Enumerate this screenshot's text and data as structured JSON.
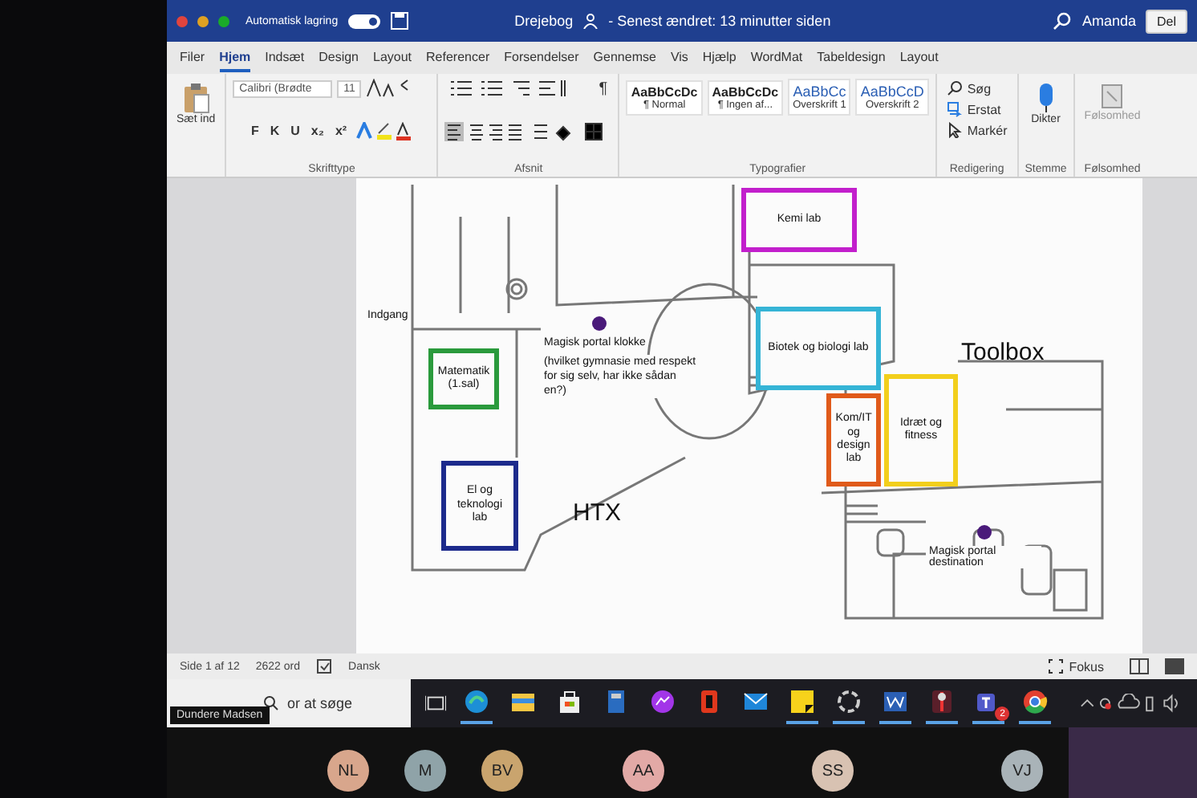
{
  "window": {
    "title": "Drejebog",
    "saved_status": "- Senest ændret: 13 minutter siden",
    "user": "Amanda",
    "share_button": "Del",
    "autosave": {
      "label": "Automatisk lagring",
      "on": true
    }
  },
  "tabs": [
    {
      "label": "Filer",
      "selected": false
    },
    {
      "label": "Hjem",
      "selected": true
    },
    {
      "label": "Indsæt",
      "selected": false
    },
    {
      "label": "Design",
      "selected": false
    },
    {
      "label": "Layout",
      "selected": false
    },
    {
      "label": "Referencer",
      "selected": false
    },
    {
      "label": "Forsendelser",
      "selected": false
    },
    {
      "label": "Gennemse",
      "selected": false
    },
    {
      "label": "Vis",
      "selected": false
    },
    {
      "label": "Hjælp",
      "selected": false
    },
    {
      "label": "WordMat",
      "selected": false
    },
    {
      "label": "Tabeldesign",
      "selected": false
    },
    {
      "label": "Layout",
      "selected": false
    }
  ],
  "ribbon": {
    "clipboard": {
      "paste_label": "Sæt ind"
    },
    "font": {
      "font_name": "Calibri (Brødte",
      "font_size": "11",
      "format_buttons": [
        "F",
        "K",
        "U",
        "x₂",
        "x²"
      ],
      "group_label": "Skrifttype"
    },
    "paragraph": {
      "pilcrow": "¶",
      "group_label": "Afsnit"
    },
    "styles": {
      "items": [
        {
          "preview": "AaBbCcDc",
          "name": "¶ Normal",
          "kind": "body"
        },
        {
          "preview": "AaBbCcDc",
          "name": "¶ Ingen af...",
          "kind": "body"
        },
        {
          "preview": "AaBbCc",
          "name": "Overskrift 1",
          "kind": "heading"
        },
        {
          "preview": "AaBbCcD",
          "name": "Overskrift 2",
          "kind": "heading"
        }
      ],
      "group_label": "Typografier"
    },
    "editing": {
      "items": [
        {
          "label": "Søg",
          "kind": "search"
        },
        {
          "label": "Erstat",
          "kind": "replace"
        },
        {
          "label": "Markér",
          "kind": "select"
        }
      ],
      "group_label": "Redigering"
    },
    "voice": {
      "button": "Dikter",
      "group_label": "Stemme"
    },
    "sensitivity": {
      "button": "Følsomhed",
      "disabled": true,
      "group_label": "Følsomhed"
    }
  },
  "document": {
    "plan": {
      "buildings": [
        "HTX",
        "Toolbox"
      ],
      "entrance": "Indgang",
      "rooms": [
        {
          "label": "Kemi lab",
          "color": "#c21fcc"
        },
        {
          "label": "Matematik (1.sal)",
          "color": "#2a9a3c"
        },
        {
          "label": "Biotek og biologi lab",
          "color": "#35b4d6"
        },
        {
          "label": "El og teknologi lab",
          "color": "#1c2a8c"
        },
        {
          "label": "Kom/IT og design lab",
          "color": "#e05a1a"
        },
        {
          "label": "Idræt og fitness",
          "color": "#f2cf1c"
        }
      ],
      "portals": [
        {
          "title": "Magisk portal klokke",
          "note": "(hvilket gymnasie med respekt for sig selv, har ikke sådan en?)"
        },
        {
          "title": "Magisk portal destination"
        }
      ]
    }
  },
  "status_bar": {
    "page": "Side 1 af 12",
    "words": "2622 ord",
    "language": "Dansk",
    "focus": "Fokus"
  },
  "taskbar": {
    "search_placeholder": "or at søge",
    "name_tag": "Dundere Madsen",
    "apps": [
      {
        "kind": "edge",
        "running": true
      },
      {
        "kind": "folder",
        "running": false
      },
      {
        "kind": "store",
        "running": false
      },
      {
        "kind": "calculator",
        "running": false
      },
      {
        "kind": "messenger",
        "running": false
      },
      {
        "kind": "office",
        "running": false
      },
      {
        "kind": "mail",
        "running": false
      },
      {
        "kind": "notes",
        "running": true
      },
      {
        "kind": "ring",
        "running": true
      },
      {
        "kind": "word",
        "running": true
      },
      {
        "kind": "pin",
        "running": true
      },
      {
        "kind": "teams",
        "running": true,
        "badge": "2"
      },
      {
        "kind": "chrome",
        "running": true
      }
    ]
  },
  "meeting": {
    "participants": [
      {
        "initials": "NL",
        "color": "#d8a68c"
      },
      {
        "initials": "M",
        "color": "#8fa3a8"
      },
      {
        "initials": "BV",
        "color": "#c9a46e"
      },
      {
        "initials": "AA",
        "color": "#e2a9a6"
      },
      {
        "initials": "SS",
        "color": "#d8c2b2"
      },
      {
        "initials": "VJ",
        "color": "#a9b3b8"
      }
    ]
  }
}
